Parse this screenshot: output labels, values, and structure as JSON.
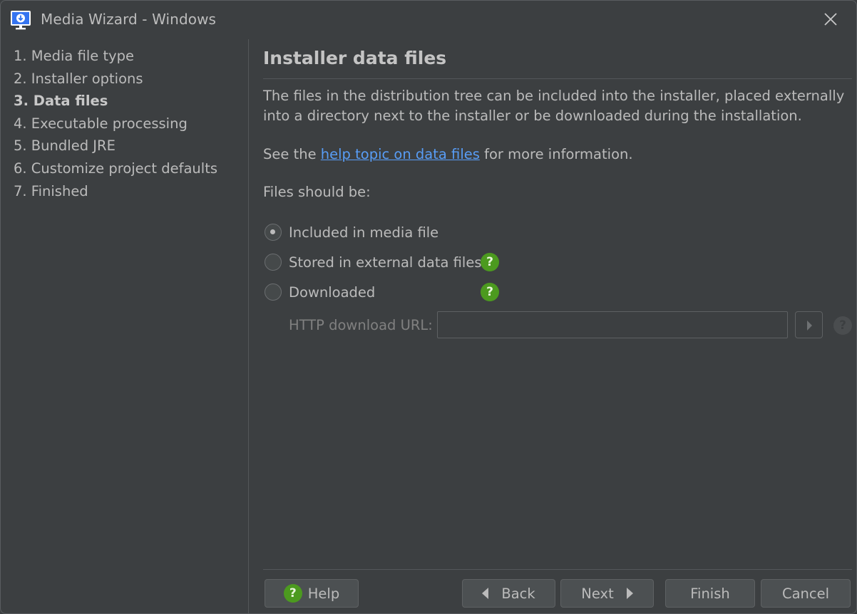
{
  "window": {
    "title": "Media Wizard - Windows"
  },
  "steps": [
    "1. Media file type",
    "2. Installer options",
    "3. Data files",
    "4. Executable processing",
    "5. Bundled JRE",
    "6. Customize project defaults",
    "7. Finished"
  ],
  "active_step_index": 2,
  "page": {
    "heading": "Installer data files",
    "description": "The files in the distribution tree can be included into the installer, placed externally into a directory next to the installer or be downloaded during the installation.",
    "see_prefix": "See the ",
    "see_link": "help topic on data files",
    "see_suffix": " for more information.",
    "files_label": "Files should be:",
    "options": [
      {
        "label": "Included in media file",
        "selected": true
      },
      {
        "label": "Stored in external data files",
        "selected": false
      },
      {
        "label": "Downloaded",
        "selected": false
      }
    ],
    "url_label": "HTTP download URL:",
    "url_value": ""
  },
  "buttons": {
    "help": "Help",
    "back": "Back",
    "next": "Next",
    "finish": "Finish",
    "cancel": "Cancel"
  },
  "icons": {
    "app": "media-monitor-icon",
    "close": "close-icon",
    "help": "question-circle-icon",
    "back": "triangle-left-icon",
    "next": "triangle-right-icon"
  },
  "colors": {
    "background": "#3c3f41",
    "link": "#589df6",
    "help_green": "#4c9a1f",
    "app_icon_blue": "#3574f0"
  }
}
